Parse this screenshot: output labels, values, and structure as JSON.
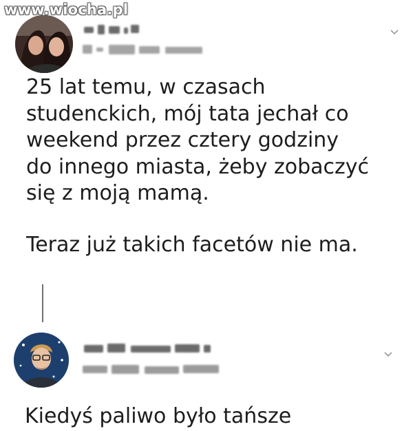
{
  "watermark": "www.wiocha.pl",
  "post": {
    "text_lines": [
      "25 lat temu, w czasach",
      "studenckich, mój tata jechał co",
      "weekend przez cztery godziny",
      "do innego miasta, żeby zobaczyć",
      "się z moją mamą."
    ],
    "text_line_2": "Teraz już takich facetów nie ma."
  },
  "reply": {
    "text": "Kiedyś paliwo było tańsze"
  },
  "icons": {
    "post_menu": "chevron-down-icon",
    "reply_menu": "chevron-down-icon"
  },
  "colors": {
    "text": "#1d1d1d",
    "thread_line": "#6f6f6f",
    "chevron": "#9a9a9a"
  }
}
